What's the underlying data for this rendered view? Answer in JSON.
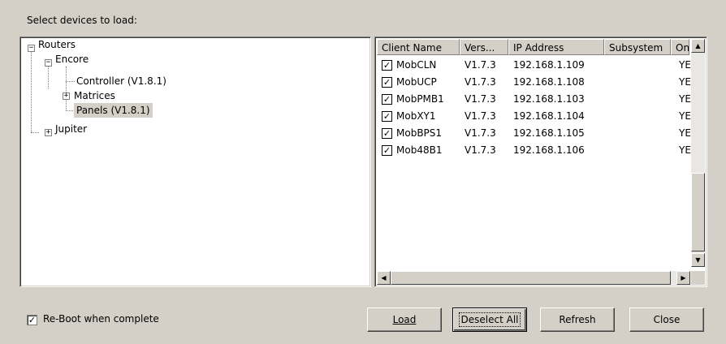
{
  "heading": "Select devices to load:",
  "tree": {
    "root": {
      "label": "Routers",
      "expander": "−"
    },
    "encore": {
      "label": "Encore",
      "expander": "−"
    },
    "controller": {
      "label": "Controller (V1.8.1)"
    },
    "matrices": {
      "label": "Matrices",
      "expander": "+"
    },
    "panels": {
      "label": "Panels (V1.8.1)"
    },
    "jupiter": {
      "label": "Jupiter",
      "expander": "+"
    }
  },
  "list": {
    "columns": [
      "Client Name",
      "Vers...",
      "IP Address",
      "Subsystem",
      "Onlin"
    ],
    "rows": [
      {
        "check": "✓",
        "name": "MobCLN",
        "version": "V1.7.3",
        "ip": "192.168.1.109",
        "subsystem": "",
        "online": "YES"
      },
      {
        "check": "✓",
        "name": "MobUCP",
        "version": "V1.7.3",
        "ip": "192.168.1.108",
        "subsystem": "",
        "online": "YES"
      },
      {
        "check": "✓",
        "name": "MobPMB1",
        "version": "V1.7.3",
        "ip": "192.168.1.103",
        "subsystem": "",
        "online": "YES"
      },
      {
        "check": "✓",
        "name": "MobXY1",
        "version": "V1.7.3",
        "ip": "192.168.1.104",
        "subsystem": "",
        "online": "YES"
      },
      {
        "check": "✓",
        "name": "MobBPS1",
        "version": "V1.7.3",
        "ip": "192.168.1.105",
        "subsystem": "",
        "online": "YES"
      },
      {
        "check": "✓",
        "name": "Mob48B1",
        "version": "V1.7.3",
        "ip": "192.168.1.106",
        "subsystem": "",
        "online": "YES"
      }
    ],
    "scroll": {
      "up": "▲",
      "down": "▼",
      "left": "◀",
      "right": "▶"
    }
  },
  "reboot": {
    "check": "✓",
    "label": "Re-Boot when complete"
  },
  "buttons": {
    "load": "Load",
    "deselect": "Deselect All",
    "refresh": "Refresh",
    "close": "Close"
  }
}
